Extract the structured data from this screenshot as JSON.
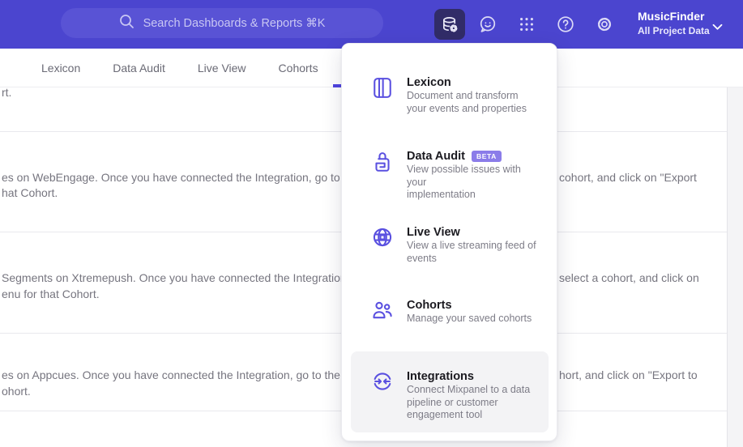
{
  "header": {
    "search_placeholder": "Search Dashboards & Reports ⌘K",
    "project_name": "MusicFinder",
    "project_scope": "All Project Data",
    "icon_names": [
      "data-management",
      "feedback",
      "apps-grid",
      "help",
      "settings"
    ]
  },
  "tabs": [
    "Lexicon",
    "Data Audit",
    "Live View",
    "Cohorts"
  ],
  "menu": {
    "items": [
      {
        "title": "Lexicon",
        "desc": [
          "Document and transform",
          "your events and properties"
        ]
      },
      {
        "title": "Data Audit",
        "badge": "BETA",
        "desc": [
          "View possible issues with your",
          "implementation"
        ]
      },
      {
        "title": "Live View",
        "desc": [
          "View a live streaming feed of",
          "events"
        ]
      },
      {
        "title": "Cohorts",
        "desc": [
          "Manage your saved cohorts"
        ]
      },
      {
        "title": "Integrations",
        "desc": [
          "Connect Mixpanel to a data",
          "pipeline or customer",
          "engagement tool"
        ]
      }
    ]
  },
  "background": {
    "row1_line2": "rt.",
    "row2_line1_left": "es on WebEngage. Once you have connected the Integration, go to the",
    "row2_line1_right": "cohort, and click on \"Export",
    "row2_line2": "hat Cohort.",
    "row3_line1_left": "Segments on Xtremepush. Once you have connected the Integration,",
    "row3_line1_right": "select a cohort, and click on",
    "row3_line2": "enu for that Cohort.",
    "row4_line1_left": "es on Appcues. Once you have connected the Integration, go to the M",
    "row4_line1_right": "hort, and click on \"Export to",
    "row4_line2": "ohort."
  },
  "colors": {
    "header_bg": "#4b45cf",
    "accent": "#4f44e0",
    "menu_icon": "#5a50e0",
    "badge_bg": "#8b7ce9",
    "highlight_bg": "#f3f3f5"
  }
}
